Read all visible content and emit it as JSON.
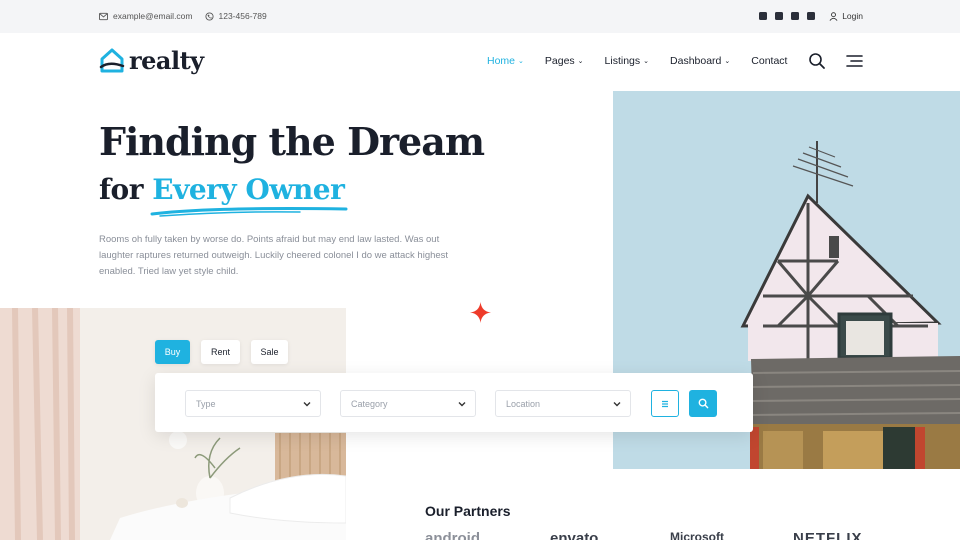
{
  "topbar": {
    "email": "example@email.com",
    "phone": "123-456-789",
    "social_icons": [
      "facebook-icon",
      "instagram-icon",
      "twitter-icon",
      "linkedin-icon"
    ],
    "login_label": "Login"
  },
  "brand": {
    "name": "realty",
    "accent_color": "#1fb2e0",
    "dark_color": "#1a1f2b",
    "star_color": "#ee3b2a"
  },
  "nav": {
    "items": [
      {
        "label": "Home",
        "dropdown": true,
        "active": true
      },
      {
        "label": "Pages",
        "dropdown": true,
        "active": false
      },
      {
        "label": "Listings",
        "dropdown": true,
        "active": false
      },
      {
        "label": "Dashboard",
        "dropdown": true,
        "active": false
      },
      {
        "label": "Contact",
        "dropdown": false,
        "active": false
      }
    ],
    "icons": [
      "search-icon",
      "menu-icon"
    ]
  },
  "hero": {
    "title_line1": "Finding the Dream",
    "title_line2_prefix": "for ",
    "title_line2_accent": "Every Owner",
    "description": "Rooms oh fully taken by worse do. Points afraid but may end law lasted. Was out laughter raptures returned outweigh. Luckily cheered colonel I do we attack highest enabled. Tried law yet style child."
  },
  "search": {
    "tabs": [
      {
        "label": "Buy",
        "active": true
      },
      {
        "label": "Rent",
        "active": false
      },
      {
        "label": "Sale",
        "active": false
      }
    ],
    "fields": {
      "type_placeholder": "Type",
      "category_placeholder": "Category",
      "location_placeholder": "Location"
    },
    "buttons": [
      "filter-icon",
      "search-icon"
    ]
  },
  "partners": {
    "title": "Our Partners",
    "logos": [
      "android",
      "envato",
      "Microsoft",
      "NETFLIX"
    ]
  }
}
